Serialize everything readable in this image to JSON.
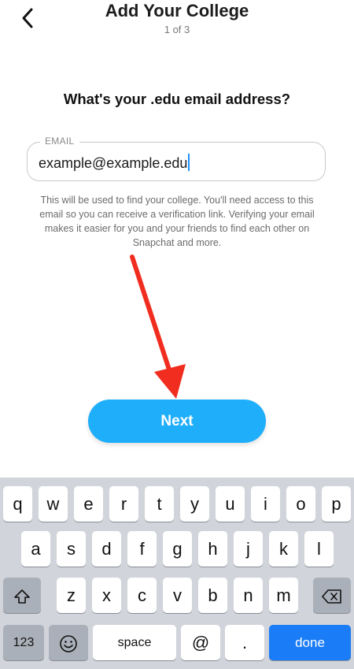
{
  "header": {
    "title": "Add Your College",
    "step": "1 of 3"
  },
  "prompt": "What's your .edu email address?",
  "email_field": {
    "label": "EMAIL",
    "value": "example@example.edu"
  },
  "help_text": "This will be used to find your college. You'll need access to this email so you can receive a verification link. Verifying your email makes it easier for you and your friends to find each other on Snapchat and more.",
  "next_label": "Next",
  "keyboard": {
    "row1": [
      "q",
      "w",
      "e",
      "r",
      "t",
      "y",
      "u",
      "i",
      "o",
      "p"
    ],
    "row2": [
      "a",
      "s",
      "d",
      "f",
      "g",
      "h",
      "j",
      "k",
      "l"
    ],
    "row3": [
      "z",
      "x",
      "c",
      "v",
      "b",
      "n",
      "m"
    ],
    "numbers_label": "123",
    "space_label": "space",
    "at_label": "@",
    "dot_label": ".",
    "done_label": "done",
    "icons": {
      "shift": "shift-icon",
      "backspace": "backspace-icon",
      "emoji": "emoji-icon"
    },
    "colors": {
      "done": "#1a7cf7"
    }
  },
  "colors": {
    "accent": "#1faefa",
    "annotation_arrow": "#f02d1f"
  }
}
